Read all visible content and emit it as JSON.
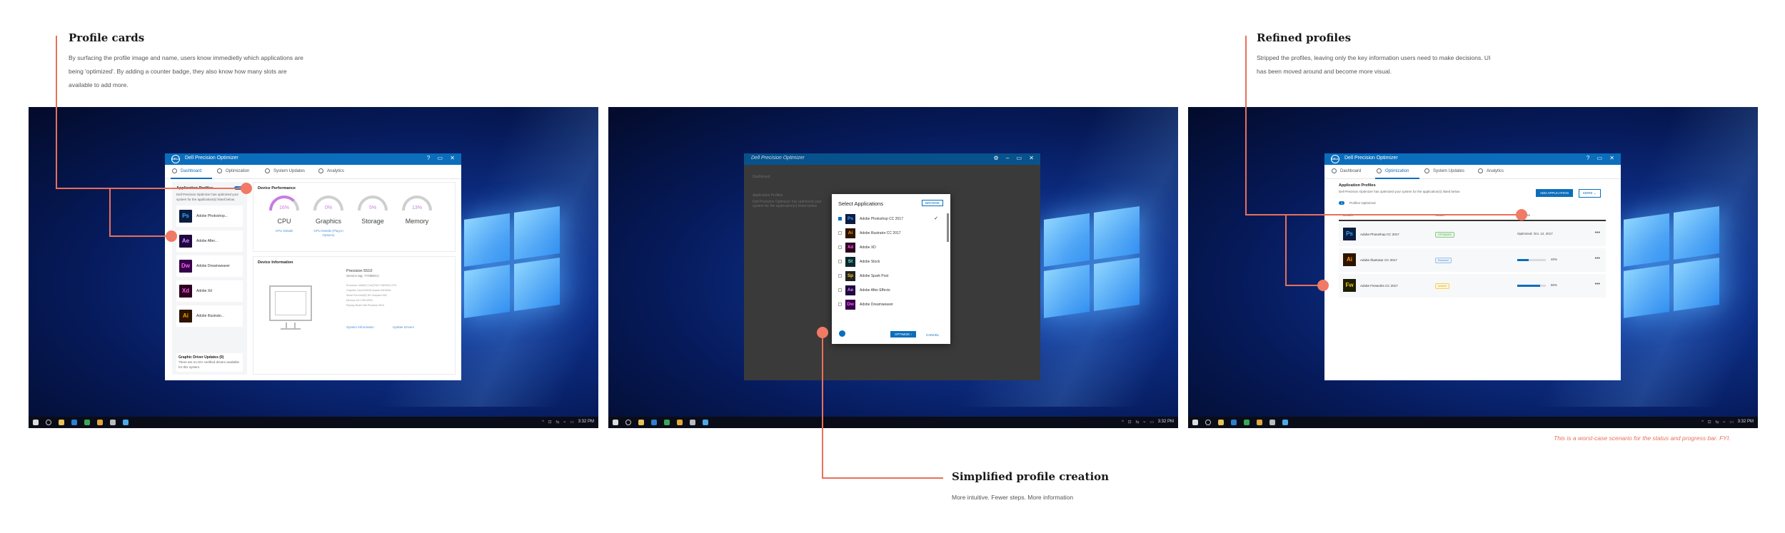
{
  "annotations": {
    "profile_cards": {
      "title": "Profile cards",
      "body": "By surfacing the profile image and name, users know immedietly which applications are being 'optimized'. By adding a counter badge, they also know how many slots are available to add more."
    },
    "refined_profiles": {
      "title": "Refined profiles",
      "body": "Stripped the profiles, leaving only the key information users need to make decisions. UI has been moved around and become more visual."
    },
    "simplified_creation": {
      "title": "Simplified profile creation",
      "body": "More intuitive. Fewer steps. More information"
    },
    "footnote": "This is a worst-case scenario for the status and progress bar. FYI."
  },
  "colors": {
    "accent": "#0a6ebd",
    "annotation": "#e8705a",
    "taskbar": "#0a0d18"
  },
  "taskbar": {
    "clock": "3:32 PM",
    "tray": "^ ⊡ ⇆ ⌁ ▭"
  },
  "app": {
    "title": "Dell Precision Optimizer",
    "controls": "? ▭ ✕",
    "tabs": [
      "Dashboard",
      "Optimization",
      "System Updates",
      "Analytics"
    ]
  },
  "screen1": {
    "sidebar": {
      "heading": "Application Profiles",
      "badge": "4/5",
      "sub": "Dell Precision Optimizer has optimized your system for the application(s) listed below.",
      "items": [
        {
          "tile": "Ps",
          "name": "Adobe Photoshop..."
        },
        {
          "tile": "Ae",
          "name": "Adobe After..."
        },
        {
          "tile": "Dw",
          "name": "Adobe Dreamweaver"
        },
        {
          "tile": "Xd",
          "name": "Adobe Xd"
        },
        {
          "tile": "Ai",
          "name": "Adobe Illustrato..."
        }
      ],
      "footer_heading": "Graphic Driver Updates (0)",
      "footer_text": "There are no ISV certified drivers available for this system."
    },
    "performance": {
      "heading": "Device Performance",
      "gauges": [
        {
          "label": "CPU",
          "value": "16%",
          "link": "CPU Details"
        },
        {
          "label": "Graphics",
          "value": "0%",
          "link": "GPU Details (Plug-in Options)"
        },
        {
          "label": "Storage",
          "value": "5%",
          "link": ""
        },
        {
          "label": "Memory",
          "value": "13%",
          "link": ""
        }
      ]
    },
    "device": {
      "heading": "Device Information",
      "name": "Precision 5510",
      "tag": "Service tag: 7YNBDC2",
      "specs": [
        "Processor      Intel(R) Core(TM) i7-6820HQ CPU",
        "Graphics Card   NVIDIA Quadro M1000M",
        "Serial Port     Intel(R) HD Graphics 530",
        "Memory          16.0 GB DDR4",
        "Display Model   Dell Precision 5510"
      ],
      "link1": "System Information",
      "link2": "Update Drivers"
    }
  },
  "screen2": {
    "dim_heading": "Application Profiles",
    "dim_sub": "Dell Precision Optimizer has optimized your system for the application(s) listed below.",
    "dialog": {
      "title": "Select Applications",
      "browse": "BROWSE",
      "apps": [
        {
          "tile": "Ps",
          "name": "Adobe Photoshop CC 2017",
          "checked": true
        },
        {
          "tile": "Ai",
          "name": "Adobe Illustrator CC 2017",
          "checked": false
        },
        {
          "tile": "Xd",
          "name": "Adobe XD",
          "checked": false
        },
        {
          "tile": "St",
          "name": "Adobe Stock",
          "checked": false
        },
        {
          "tile": "Sp",
          "name": "Adobe Spark Post",
          "checked": false
        },
        {
          "tile": "Ae",
          "name": "Adobe After Effects",
          "checked": false
        },
        {
          "tile": "Dw",
          "name": "Adobe Dreamweaver",
          "checked": false
        }
      ],
      "primary": "OPTIMIZE ›",
      "cancel": "CANCEL"
    }
  },
  "screen3": {
    "heading": "Application Profiles",
    "sub": "Dell Precision Optimizer has optimized your system for the application(s) listed below",
    "add_button": "ADD APPLICATION",
    "more_button": "MORE ⌄",
    "count": "3",
    "count_label": "Profiles Optimized",
    "columns": [
      "Details",
      "Status",
      "Progress"
    ],
    "rows": [
      {
        "tile": "Ps",
        "name": "Adobe Photoshop CC 2017",
        "status": "OPTIMIZED",
        "progress_text": "Optimized: Oct. 12, 2017",
        "progress": null
      },
      {
        "tile": "Ai",
        "name": "Adobe Illustrator CC 2017",
        "status": "Resolved",
        "progress_text": "",
        "progress": 0.4,
        "pct": "40%"
      },
      {
        "tile": "Fw",
        "name": "Adobe Fireworks CC 2017",
        "status": "Unseen",
        "progress_text": "",
        "progress": 0.8,
        "pct": "80%"
      }
    ]
  }
}
